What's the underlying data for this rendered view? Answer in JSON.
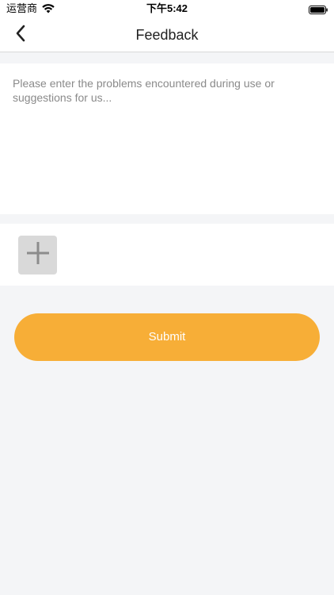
{
  "status_bar": {
    "carrier": "运营商",
    "time": "下午5:42"
  },
  "nav": {
    "title": "Feedback",
    "back_icon": "chevron-left-icon"
  },
  "feedback": {
    "value": "",
    "placeholder": "Please enter the problems encountered during use or suggestions for us..."
  },
  "images": {
    "add_icon": "plus-icon"
  },
  "submit": {
    "label": "Submit"
  },
  "colors": {
    "accent": "#f7ae37",
    "background": "#f4f5f7",
    "card": "#ffffff",
    "add_button_bg": "#d9d9d9"
  }
}
